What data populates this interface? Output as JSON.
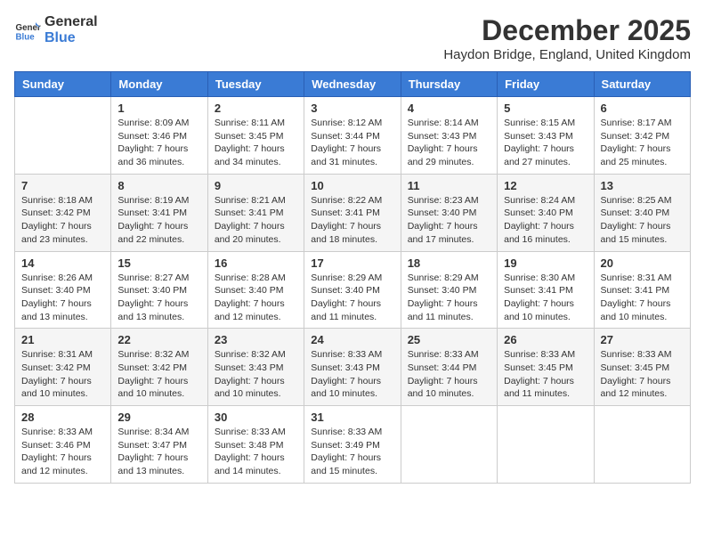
{
  "logo": {
    "general": "General",
    "blue": "Blue"
  },
  "title": "December 2025",
  "location": "Haydon Bridge, England, United Kingdom",
  "days_of_week": [
    "Sunday",
    "Monday",
    "Tuesday",
    "Wednesday",
    "Thursday",
    "Friday",
    "Saturday"
  ],
  "weeks": [
    [
      {
        "day": "",
        "info": ""
      },
      {
        "day": "1",
        "info": "Sunrise: 8:09 AM\nSunset: 3:46 PM\nDaylight: 7 hours\nand 36 minutes."
      },
      {
        "day": "2",
        "info": "Sunrise: 8:11 AM\nSunset: 3:45 PM\nDaylight: 7 hours\nand 34 minutes."
      },
      {
        "day": "3",
        "info": "Sunrise: 8:12 AM\nSunset: 3:44 PM\nDaylight: 7 hours\nand 31 minutes."
      },
      {
        "day": "4",
        "info": "Sunrise: 8:14 AM\nSunset: 3:43 PM\nDaylight: 7 hours\nand 29 minutes."
      },
      {
        "day": "5",
        "info": "Sunrise: 8:15 AM\nSunset: 3:43 PM\nDaylight: 7 hours\nand 27 minutes."
      },
      {
        "day": "6",
        "info": "Sunrise: 8:17 AM\nSunset: 3:42 PM\nDaylight: 7 hours\nand 25 minutes."
      }
    ],
    [
      {
        "day": "7",
        "info": "Sunrise: 8:18 AM\nSunset: 3:42 PM\nDaylight: 7 hours\nand 23 minutes."
      },
      {
        "day": "8",
        "info": "Sunrise: 8:19 AM\nSunset: 3:41 PM\nDaylight: 7 hours\nand 22 minutes."
      },
      {
        "day": "9",
        "info": "Sunrise: 8:21 AM\nSunset: 3:41 PM\nDaylight: 7 hours\nand 20 minutes."
      },
      {
        "day": "10",
        "info": "Sunrise: 8:22 AM\nSunset: 3:41 PM\nDaylight: 7 hours\nand 18 minutes."
      },
      {
        "day": "11",
        "info": "Sunrise: 8:23 AM\nSunset: 3:40 PM\nDaylight: 7 hours\nand 17 minutes."
      },
      {
        "day": "12",
        "info": "Sunrise: 8:24 AM\nSunset: 3:40 PM\nDaylight: 7 hours\nand 16 minutes."
      },
      {
        "day": "13",
        "info": "Sunrise: 8:25 AM\nSunset: 3:40 PM\nDaylight: 7 hours\nand 15 minutes."
      }
    ],
    [
      {
        "day": "14",
        "info": "Sunrise: 8:26 AM\nSunset: 3:40 PM\nDaylight: 7 hours\nand 13 minutes."
      },
      {
        "day": "15",
        "info": "Sunrise: 8:27 AM\nSunset: 3:40 PM\nDaylight: 7 hours\nand 13 minutes."
      },
      {
        "day": "16",
        "info": "Sunrise: 8:28 AM\nSunset: 3:40 PM\nDaylight: 7 hours\nand 12 minutes."
      },
      {
        "day": "17",
        "info": "Sunrise: 8:29 AM\nSunset: 3:40 PM\nDaylight: 7 hours\nand 11 minutes."
      },
      {
        "day": "18",
        "info": "Sunrise: 8:29 AM\nSunset: 3:40 PM\nDaylight: 7 hours\nand 11 minutes."
      },
      {
        "day": "19",
        "info": "Sunrise: 8:30 AM\nSunset: 3:41 PM\nDaylight: 7 hours\nand 10 minutes."
      },
      {
        "day": "20",
        "info": "Sunrise: 8:31 AM\nSunset: 3:41 PM\nDaylight: 7 hours\nand 10 minutes."
      }
    ],
    [
      {
        "day": "21",
        "info": "Sunrise: 8:31 AM\nSunset: 3:42 PM\nDaylight: 7 hours\nand 10 minutes."
      },
      {
        "day": "22",
        "info": "Sunrise: 8:32 AM\nSunset: 3:42 PM\nDaylight: 7 hours\nand 10 minutes."
      },
      {
        "day": "23",
        "info": "Sunrise: 8:32 AM\nSunset: 3:43 PM\nDaylight: 7 hours\nand 10 minutes."
      },
      {
        "day": "24",
        "info": "Sunrise: 8:33 AM\nSunset: 3:43 PM\nDaylight: 7 hours\nand 10 minutes."
      },
      {
        "day": "25",
        "info": "Sunrise: 8:33 AM\nSunset: 3:44 PM\nDaylight: 7 hours\nand 10 minutes."
      },
      {
        "day": "26",
        "info": "Sunrise: 8:33 AM\nSunset: 3:45 PM\nDaylight: 7 hours\nand 11 minutes."
      },
      {
        "day": "27",
        "info": "Sunrise: 8:33 AM\nSunset: 3:45 PM\nDaylight: 7 hours\nand 12 minutes."
      }
    ],
    [
      {
        "day": "28",
        "info": "Sunrise: 8:33 AM\nSunset: 3:46 PM\nDaylight: 7 hours\nand 12 minutes."
      },
      {
        "day": "29",
        "info": "Sunrise: 8:34 AM\nSunset: 3:47 PM\nDaylight: 7 hours\nand 13 minutes."
      },
      {
        "day": "30",
        "info": "Sunrise: 8:33 AM\nSunset: 3:48 PM\nDaylight: 7 hours\nand 14 minutes."
      },
      {
        "day": "31",
        "info": "Sunrise: 8:33 AM\nSunset: 3:49 PM\nDaylight: 7 hours\nand 15 minutes."
      },
      {
        "day": "",
        "info": ""
      },
      {
        "day": "",
        "info": ""
      },
      {
        "day": "",
        "info": ""
      }
    ]
  ]
}
